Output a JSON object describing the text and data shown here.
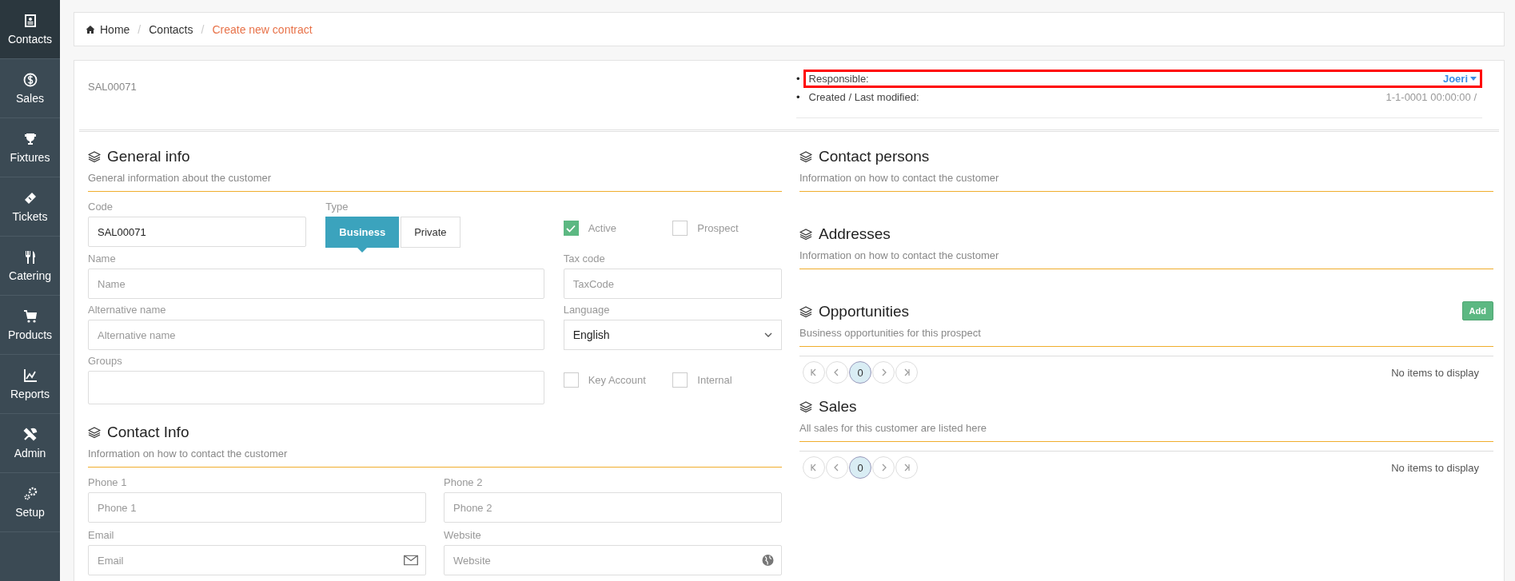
{
  "sidebar": {
    "items": [
      {
        "label": "Contacts",
        "selected": true
      },
      {
        "label": "Sales",
        "selected": false
      },
      {
        "label": "Fixtures",
        "selected": false
      },
      {
        "label": "Tickets",
        "selected": false
      },
      {
        "label": "Catering",
        "selected": false
      },
      {
        "label": "Products",
        "selected": false
      },
      {
        "label": "Reports",
        "selected": false
      },
      {
        "label": "Admin",
        "selected": false
      },
      {
        "label": "Setup",
        "selected": false
      }
    ]
  },
  "breadcrumb": [
    {
      "label": "Home",
      "current": false
    },
    {
      "separator": "/",
      "label": "Contacts",
      "current": false
    },
    {
      "separator": "/",
      "label": "Create new contract",
      "current": true
    }
  ],
  "record": {
    "code": "SAL00071",
    "meta": [
      {
        "bullet": "•",
        "label": "Responsible:",
        "value": "Joeri",
        "kind": "dropdown",
        "highlighted": true
      },
      {
        "bullet": "•",
        "label": "Created / Last modified:",
        "value": "1-1-0001 00:00:00 /",
        "kind": "text",
        "highlighted": false
      }
    ]
  },
  "general_info": {
    "title": "General info",
    "subtitle": "General information about the customer",
    "code": {
      "label": "Code",
      "value": "SAL00071"
    },
    "type": {
      "label": "Type",
      "options": [
        {
          "label": "Business",
          "selected": true
        },
        {
          "label": "Private",
          "selected": false
        }
      ]
    },
    "flags_top": [
      {
        "label": "Active",
        "checked": true
      },
      {
        "label": "Prospect",
        "checked": false
      }
    ],
    "name": {
      "label": "Name",
      "placeholder": "Name"
    },
    "tax_code": {
      "label": "Tax code",
      "placeholder": "TaxCode"
    },
    "alternative_name": {
      "label": "Alternative name",
      "placeholder": "Alternative name"
    },
    "language": {
      "label": "Language",
      "value": "English"
    },
    "groups": {
      "label": "Groups"
    },
    "flags_bottom": [
      {
        "label": "Key Account",
        "checked": false
      },
      {
        "label": "Internal",
        "checked": false
      }
    ]
  },
  "contact_info": {
    "title": "Contact Info",
    "subtitle": "Information on how to contact the customer",
    "fields": [
      {
        "label": "Phone 1",
        "placeholder": "Phone 1",
        "kind": "plain"
      },
      {
        "label": "Phone 2",
        "placeholder": "Phone 2",
        "kind": "plain"
      },
      {
        "label": "Email",
        "placeholder": "Email",
        "kind": "email"
      },
      {
        "label": "Website",
        "placeholder": "Website",
        "kind": "web"
      }
    ]
  },
  "right_sections": [
    {
      "title": "Contact persons",
      "subtitle": "Information on how to contact the customer"
    },
    {
      "title": "Addresses",
      "subtitle": "Information on how to contact the customer"
    },
    {
      "title": "Opportunities",
      "subtitle": "Business opportunities for this prospect",
      "add_button": "Add",
      "pager": {
        "page": "0",
        "empty_text": "No items to display"
      }
    },
    {
      "title": "Sales",
      "subtitle": "All sales for this customer are listed here",
      "pager": {
        "page": "0",
        "empty_text": "No items to display"
      }
    }
  ]
}
